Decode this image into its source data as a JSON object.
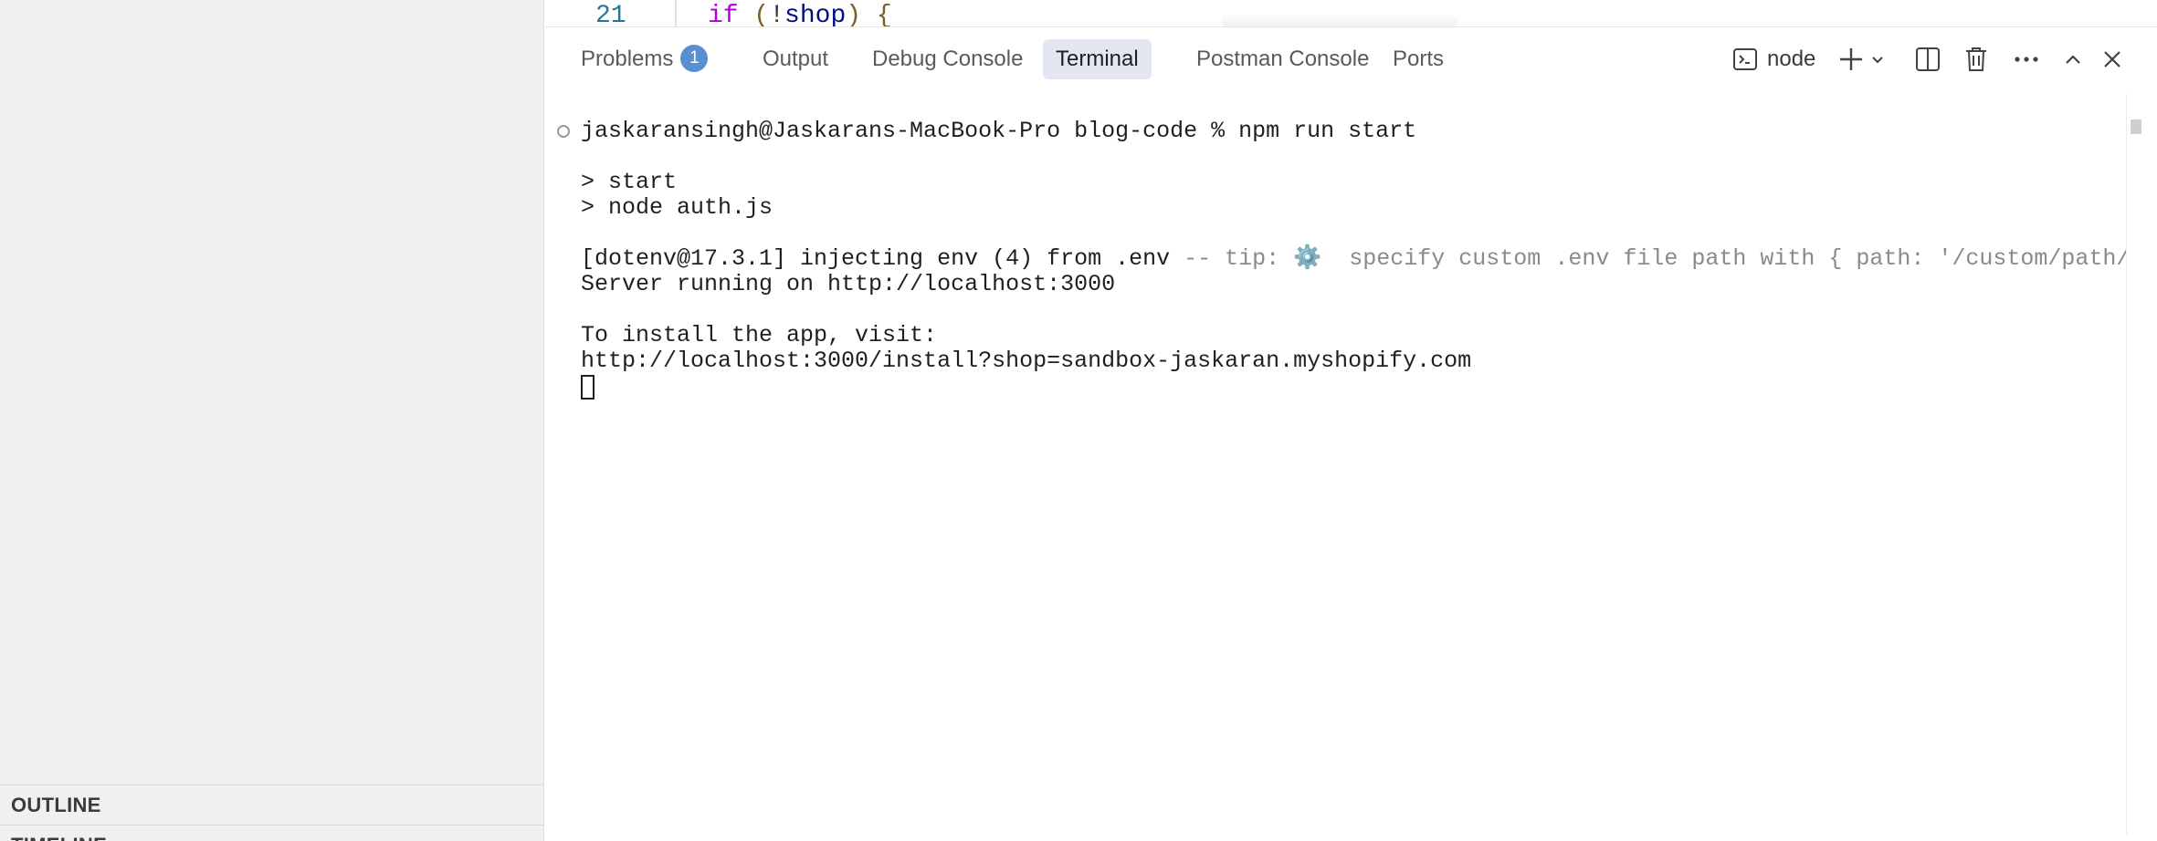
{
  "sidebar": {
    "sections": [
      "OUTLINE",
      "TIMELINE"
    ]
  },
  "editor": {
    "line_number": "21",
    "code": {
      "keyword": "if",
      "open": " (",
      "bang": "!",
      "ident": "shop",
      "close": ") {"
    }
  },
  "panel": {
    "tabs": [
      {
        "label": "Problems",
        "badge": "1"
      },
      {
        "label": "Output"
      },
      {
        "label": "Debug Console"
      },
      {
        "label": "Terminal",
        "active": true
      },
      {
        "label": "Postman Console"
      },
      {
        "label": "Ports"
      }
    ],
    "terminal_name": "node"
  },
  "terminal": {
    "lines": [
      "jaskaransingh@Jaskarans-MacBook-Pro blog-code % npm run start",
      "> start",
      "> node auth.js",
      "[dotenv@17.3.1] injecting env (4) from .env",
      "-- tip: ⚙️  specify custom .env file path with { path: '/custom/path/.env' }",
      "Server running on http://localhost:3000",
      "To install the app, visit:",
      "http://localhost:3000/install?shop=sandbox-jaskaran.myshopify.com"
    ]
  },
  "colors": {
    "accent": "#5a8fd4",
    "active_tab_bg": "#e4e6f1",
    "sidebar_bg": "#f0f0f0"
  }
}
